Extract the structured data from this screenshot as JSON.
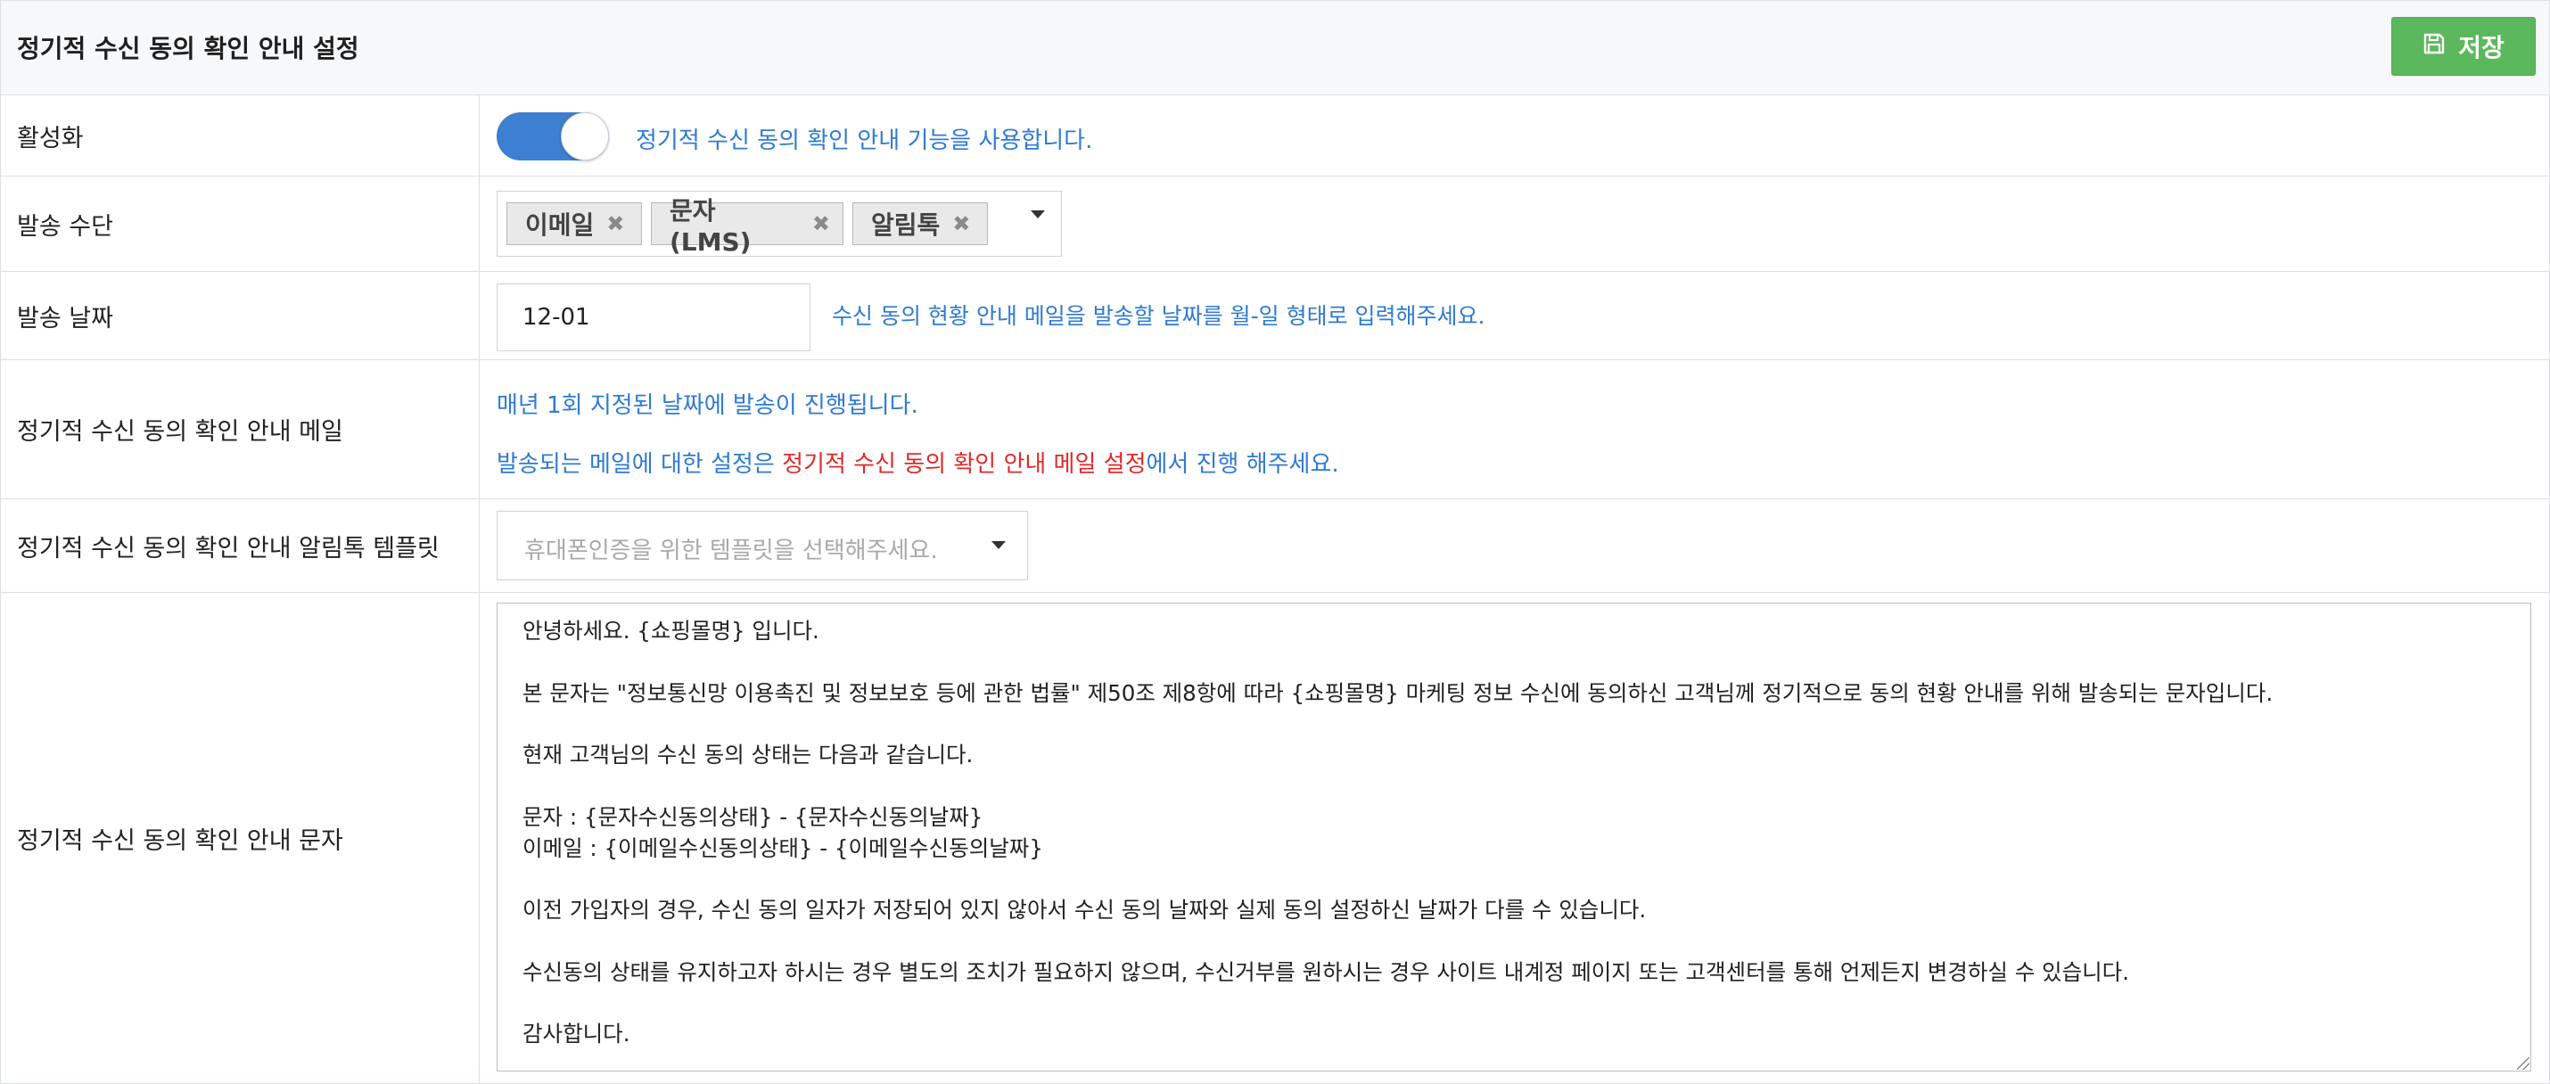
{
  "header": {
    "title": "정기적 수신 동의 확인 안내 설정",
    "save_label": "저장"
  },
  "rows": {
    "activation": {
      "label": "활성화",
      "toggle_on": true,
      "description": "정기적 수신 동의 확인 안내 기능을 사용합니다."
    },
    "send_method": {
      "label": "발송 수단",
      "tags": [
        "이메일",
        "문자 (LMS)",
        "알림톡"
      ]
    },
    "send_date": {
      "label": "발송 날짜",
      "value": "12-01",
      "help": "수신 동의 현황 안내 메일을 발송할 날짜를 월-일 형태로 입력해주세요."
    },
    "mail": {
      "label": "정기적 수신 동의 확인 안내 메일",
      "line1": "매년 1회 지정된 날짜에 발송이 진행됩니다.",
      "line2_prefix": "발송되는 메일에 대한 설정은 ",
      "line2_link": "정기적 수신 동의 확인 안내 메일 설정",
      "line2_suffix": "에서 진행 해주세요."
    },
    "alimtalk_template": {
      "label": "정기적 수신 동의 확인 안내 알림톡 템플릿",
      "placeholder": "휴대폰인증을 위한 템플릿을 선택해주세요."
    },
    "sms": {
      "label": "정기적 수신 동의 확인 안내 문자",
      "text": "안녕하세요. {쇼핑몰명} 입니다.\n\n본 문자는 \"정보통신망 이용촉진 및 정보보호 등에 관한 법률\" 제50조 제8항에 따라 {쇼핑몰명} 마케팅 정보 수신에 동의하신 고객님께 정기적으로 동의 현황 안내를 위해 발송되는 문자입니다.\n\n현재 고객님의 수신 동의 상태는 다음과 같습니다.\n\n문자 : {문자수신동의상태} - {문자수신동의날짜}\n이메일 : {이메일수신동의상태} - {이메일수신동의날짜}\n\n이전 가입자의 경우, 수신 동의 일자가 저장되어 있지 않아서 수신 동의 날짜와 실제 동의 설정하신 날짜가 다를 수 있습니다.\n\n수신동의 상태를 유지하고자 하시는 경우 별도의 조치가 필요하지 않으며, 수신거부를 원하시는 경우 사이트 내계정 페이지 또는 고객센터를 통해 언제든지 변경하실 수 있습니다.\n\n감사합니다."
    }
  },
  "colors": {
    "save_button": "#5cb85c",
    "toggle_on": "#3d7fd0",
    "info_text": "#2f7bd1",
    "link_text": "#e02a2a"
  },
  "icons": {
    "save": "floppy-disk-icon",
    "tag_remove": "close-icon",
    "dropdown": "chevron-down-icon"
  }
}
